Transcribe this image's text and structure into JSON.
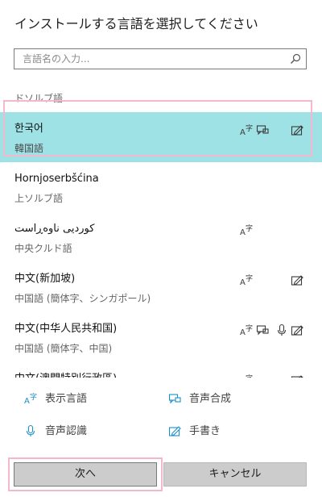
{
  "title": "インストールする言語を選択してください",
  "search": {
    "placeholder": "言語名の入力..."
  },
  "languages": [
    {
      "name": "",
      "sub": "ドソルブ語",
      "features": [],
      "selected": false
    },
    {
      "name": "한국어",
      "sub": "韓国語",
      "features": [
        "display",
        "tts",
        "handwriting"
      ],
      "selected": true
    },
    {
      "name": "Hornjoserbšćina",
      "sub": "上ソルブ語",
      "features": [],
      "selected": false
    },
    {
      "name": "کوردیی ناوەڕاست",
      "sub": "中央クルド語",
      "features": [
        "display"
      ],
      "selected": false
    },
    {
      "name": "中文(新加坡)",
      "sub": "中国語 (簡体字、シンガポール)",
      "features": [
        "display",
        "handwriting"
      ],
      "selected": false
    },
    {
      "name": "中文(中华人民共和国)",
      "sub": "中国語 (簡体字、中国)",
      "features": [
        "display",
        "tts",
        "speech",
        "handwriting"
      ],
      "selected": false
    },
    {
      "name": "中文(澳門特別行政區)",
      "sub": "",
      "features": [
        "display",
        "handwriting"
      ],
      "selected": false
    }
  ],
  "legend": {
    "display": "表示言語",
    "tts": "音声合成",
    "speech": "音声認識",
    "handwriting": "手書き"
  },
  "buttons": {
    "next": "次へ",
    "cancel": "キャンセル"
  },
  "colors": {
    "selected_bg": "#9fe2e6",
    "highlight_outline": "#f4b7cd",
    "icon": "#3a3a3a",
    "accent_icon": "#1b8fc9"
  }
}
